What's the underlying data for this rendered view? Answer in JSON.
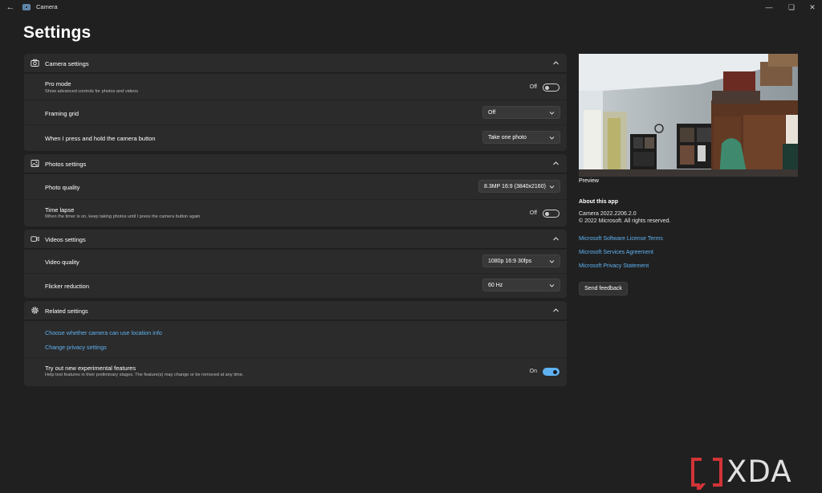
{
  "window": {
    "title": "Camera"
  },
  "page": {
    "title": "Settings"
  },
  "camera_settings": {
    "header": "Camera settings",
    "pro_mode": {
      "label": "Pro mode",
      "description": "Show advanced controls for photos and videos",
      "state": "Off"
    },
    "framing_grid": {
      "label": "Framing grid",
      "value": "Off"
    },
    "press_hold": {
      "label": "When I press and hold the camera button",
      "value": "Take one photo"
    }
  },
  "photos_settings": {
    "header": "Photos settings",
    "photo_quality": {
      "label": "Photo quality",
      "value": "8.3MP 16:9 (3840x2160)"
    },
    "time_lapse": {
      "label": "Time lapse",
      "description": "When the timer is on, keep taking photos until I press the camera button again",
      "state": "Off"
    }
  },
  "videos_settings": {
    "header": "Videos settings",
    "video_quality": {
      "label": "Video quality",
      "value": "1080p 16:9 30fps"
    },
    "flicker_reduction": {
      "label": "Flicker reduction",
      "value": "60 Hz"
    }
  },
  "related_settings": {
    "header": "Related settings",
    "location_link": "Choose whether camera can use location info",
    "privacy_link": "Change privacy settings",
    "experimental": {
      "label": "Try out new experimental features",
      "description": "Help test features in their preliminary stages. The feature(s) may change or be removed at any time.",
      "state": "On"
    }
  },
  "preview": {
    "label": "Preview"
  },
  "about": {
    "title": "About this app",
    "version": "Camera   2022.2206.2.0",
    "copyright": "© 2022 Microsoft. All rights reserved.",
    "links": [
      "Microsoft Software License Terms",
      "Microsoft Services Agreement",
      "Microsoft Privacy Statement"
    ],
    "feedback_button": "Send feedback"
  },
  "watermark": {
    "text": "XDA"
  },
  "colors": {
    "background": "#202020",
    "panel": "#2b2b2b",
    "accent": "#5fb2f2",
    "watermark_red": "#d13438"
  }
}
